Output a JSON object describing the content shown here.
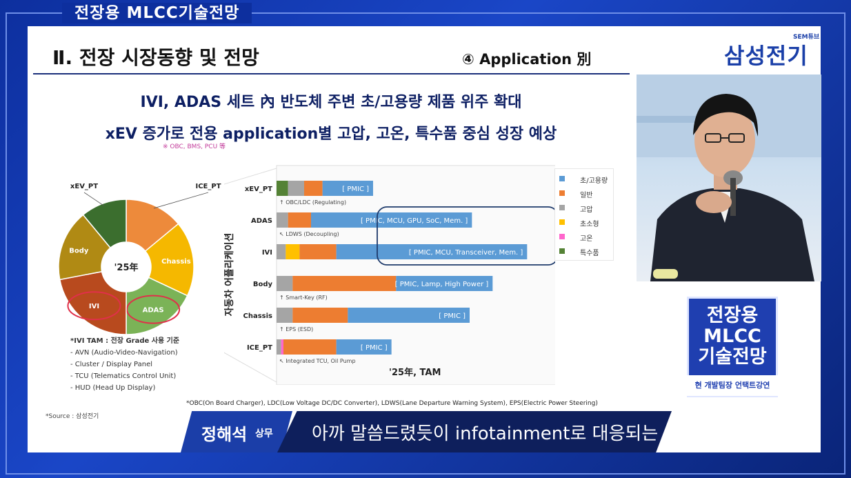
{
  "broadcast": {
    "top_title": "전장용 MLCC기술전망",
    "brand_sub": "SEM튜브",
    "brand_name": "삼성전기",
    "logo_lines": [
      "전장용",
      "MLCC",
      "기술전망"
    ],
    "logo_band": "현 개발팀장 언택트강연"
  },
  "caption": {
    "name": "정해석",
    "title": "상무",
    "text": "아까 말씀드렸듯이 infotainment로 대응되는"
  },
  "slide": {
    "title": "Ⅱ. 전장 시장동향 및 전망",
    "app_label": "④ Application 別",
    "headline1": "IVI, ADAS 세트 內 반도체 주변 초/고용량 제품 위주 확대",
    "headline2": "xEV 증가로 전용 application별 고압, 고온, 특수품 중심 성장 예상",
    "note_obc": "※ OBC, BMS, PCU 等",
    "tam_notes": {
      "heading": "*IVI TAM : 전장 Grade 사용 기준",
      "items": [
        "- AVN (Audio-Video-Navigation)",
        "- Cluster / Display Panel",
        "- TCU (Telematics Control Unit)",
        "- HUD (Head Up Display)"
      ]
    },
    "source": "*Source : 삼성전기",
    "footnote": "*OBC(On Board Charger), LDC(Low Voltage DC/DC Converter), LDWS(Lane Departure Warning System), EPS(Electric Power Steering)"
  },
  "colors": {
    "초/고용량": "#5b9bd5",
    "일반": "#ed7d31",
    "고압": "#a5a5a5",
    "초소형": "#ffc000",
    "고온": "#ff66cc",
    "특수품": "#548235",
    "xEV_PT": "#3b6e2e",
    "ICE_PT": "#ed8a3b",
    "Chassis": "#f5b800",
    "ADAS": "#7bb357",
    "IVI": "#b84a1e",
    "Body": "#b08a14"
  },
  "chart_data": [
    {
      "type": "pie",
      "title": "",
      "center_label": "'25年",
      "slices": [
        {
          "label": "ICE_PT",
          "value": 14
        },
        {
          "label": "Chassis",
          "value": 18
        },
        {
          "label": "ADAS",
          "value": 18
        },
        {
          "label": "IVI",
          "value": 22
        },
        {
          "label": "Body",
          "value": 17
        },
        {
          "label": "xEV_PT",
          "value": 11
        }
      ],
      "highlighted": [
        "IVI",
        "ADAS"
      ]
    },
    {
      "type": "bar",
      "orientation": "horizontal",
      "stacked": true,
      "title": "",
      "xlabel": "'25年, TAM",
      "ylabel": "자동차 어플리케이션",
      "categories": [
        "xEV_PT",
        "ADAS",
        "IVI",
        "Body",
        "Chassis",
        "ICE_PT"
      ],
      "series": [
        {
          "name": "특수품",
          "values": [
            5,
            0,
            0,
            0,
            0,
            0
          ]
        },
        {
          "name": "고압",
          "values": [
            7,
            5,
            4,
            7,
            7,
            2
          ]
        },
        {
          "name": "초소형",
          "values": [
            0,
            0,
            6,
            0,
            0,
            0
          ]
        },
        {
          "name": "고온",
          "values": [
            0,
            0,
            0,
            0,
            0,
            1
          ]
        },
        {
          "name": "일반",
          "values": [
            8,
            10,
            16,
            45,
            24,
            23
          ]
        },
        {
          "name": "초/고용량",
          "values": [
            22,
            70,
            83,
            42,
            53,
            24
          ]
        }
      ],
      "bar_labels": [
        "[ PMIC ]",
        "[ PMIC, MCU, GPU, SoC, Mem. ]",
        "[ PMIC, MCU, Transceiver, Mem. ]",
        "[ PMIC, Lamp, High Power ]",
        "[ PMIC ]",
        "[ PMIC ]"
      ],
      "sub_labels": [
        "↑ OBC/LDC (Regulating)",
        "↖ LDWS (Decoupling)",
        "",
        "↑ Smart-Key (RF)",
        "↑ EPS (ESD)",
        "↖ Integrated TCU, Oil Pump"
      ],
      "legend": [
        "초/고용량",
        "일반",
        "고압",
        "초소형",
        "고온",
        "특수품"
      ],
      "legend_position": "right",
      "highlighted": [
        "ADAS",
        "IVI"
      ]
    }
  ]
}
